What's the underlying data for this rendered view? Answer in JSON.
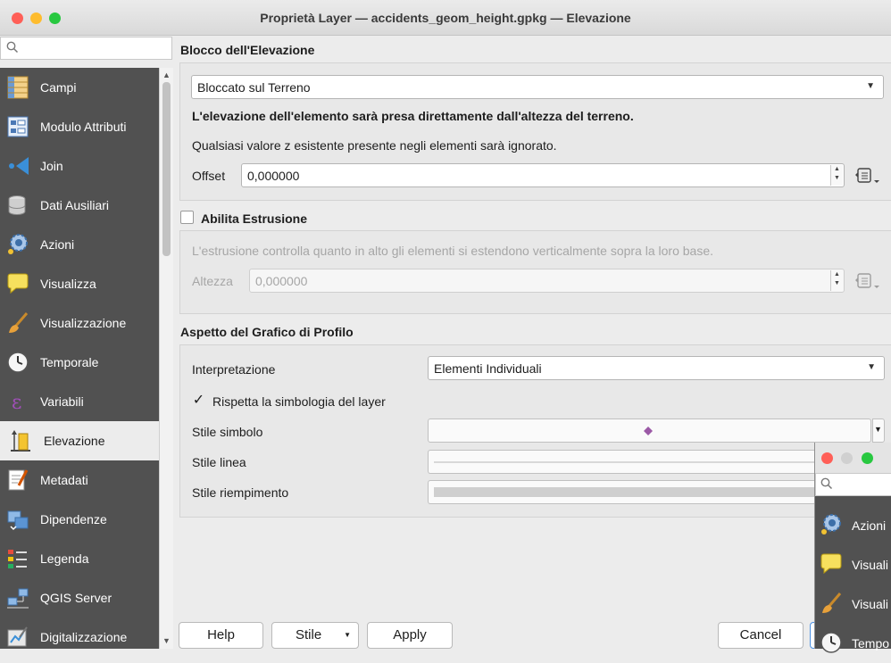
{
  "window": {
    "title": "Proprietà Layer — accidents_geom_height.gpkg — Elevazione",
    "traffic_colors": [
      "#ff5f57",
      "#febc2e",
      "#28c840"
    ]
  },
  "search": {
    "icon": "search-icon",
    "placeholder": ""
  },
  "sidebar": {
    "items": [
      {
        "label": "Campi",
        "icon": "fields-table-icon"
      },
      {
        "label": "Modulo Attributi",
        "icon": "attribute-form-icon"
      },
      {
        "label": "Join",
        "icon": "join-icon"
      },
      {
        "label": "Dati Ausiliari",
        "icon": "auxiliary-data-icon"
      },
      {
        "label": "Azioni",
        "icon": "actions-gear-icon"
      },
      {
        "label": "Visualizza",
        "icon": "display-speech-bubble-icon"
      },
      {
        "label": "Visualizzazione",
        "icon": "rendering-brush-icon"
      },
      {
        "label": "Temporale",
        "icon": "temporal-clock-icon"
      },
      {
        "label": "Variabili",
        "icon": "variables-epsilon-icon"
      },
      {
        "label": "Elevazione",
        "icon": "elevation-icon"
      },
      {
        "label": "Metadati",
        "icon": "metadata-icon"
      },
      {
        "label": "Dipendenze",
        "icon": "dependencies-icon"
      },
      {
        "label": "Legenda",
        "icon": "legend-icon"
      },
      {
        "label": "QGIS Server",
        "icon": "qgis-server-icon"
      },
      {
        "label": "Digitalizzazione",
        "icon": "digitizing-icon"
      }
    ],
    "active_index": 9
  },
  "elevation_clamping": {
    "title": "Blocco dell'Elevazione",
    "mode_value": "Bloccato sul Terreno",
    "description_bold": "L'elevazione dell'elemento sarà presa direttamente dall'altezza del terreno.",
    "description": "Qualsiasi valore z esistente presente negli elementi sarà ignorato.",
    "offset_label": "Offset",
    "offset_value": "0,000000"
  },
  "extrusion": {
    "title": "Abilita Estrusione",
    "enabled": false,
    "description": "L'estrusione controlla quanto in alto gli elementi si estendono verticalmente sopra la loro base.",
    "height_label": "Altezza",
    "height_value": "0,000000"
  },
  "profile_chart": {
    "title": "Aspetto del Grafico di Profilo",
    "interpretation_label": "Interpretazione",
    "interpretation_value": "Elementi Individuali",
    "respect_symbology_label": "Rispetta la simbologia del layer",
    "respect_symbology_checked": true,
    "check_mark": "✓",
    "symbol_style_label": "Stile simbolo",
    "line_style_label": "Stile linea",
    "fill_style_label": "Stile riempimento",
    "marker_color": "#9b59a6"
  },
  "buttons": {
    "help": "Help",
    "style": "Stile",
    "apply": "Apply",
    "cancel": "Cancel"
  },
  "secondary_window": {
    "items": [
      {
        "label": "Azioni",
        "icon": "actions-gear-icon"
      },
      {
        "label": "Visuali",
        "icon": "display-speech-bubble-icon"
      },
      {
        "label": "Visuali",
        "icon": "rendering-brush-icon"
      },
      {
        "label": "Tempo",
        "icon": "temporal-clock-icon"
      }
    ]
  }
}
